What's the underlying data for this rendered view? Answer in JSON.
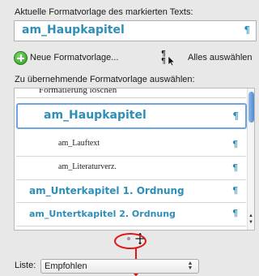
{
  "current_style": {
    "label": "Aktuelle Formatvorlage des markierten Texts:",
    "name": "am_Haupkapitel",
    "paragraph_mark": "¶"
  },
  "toolbar": {
    "new_style_label": "Neue Formatvorlage...",
    "select_all_label": "Alles auswählen"
  },
  "apply_label": "Zu übernehmende Formatvorlage auswählen:",
  "styles": [
    {
      "name": "Formatierung löschen",
      "mark": ""
    },
    {
      "name": "am_Haupkapitel",
      "mark": "¶"
    },
    {
      "name": "am_Lauftext",
      "mark": "¶"
    },
    {
      "name": "am_Literaturverz.",
      "mark": "¶"
    },
    {
      "name": "am_Unterkapitel 1. Ordnung",
      "mark": "¶"
    },
    {
      "name": "am_Untertkapitel 2. Ordnung",
      "mark": "¶"
    }
  ],
  "liste": {
    "label": "Liste:",
    "value": "Empfohlen"
  },
  "colors": {
    "style_blue": "#2d8fb8",
    "annotation_red": "#e01616",
    "selection_border": "#6ea4e0"
  },
  "icons": [
    "plus-icon",
    "select-all-icon",
    "resize-cursor-icon",
    "up-down-arrows-icon"
  ]
}
